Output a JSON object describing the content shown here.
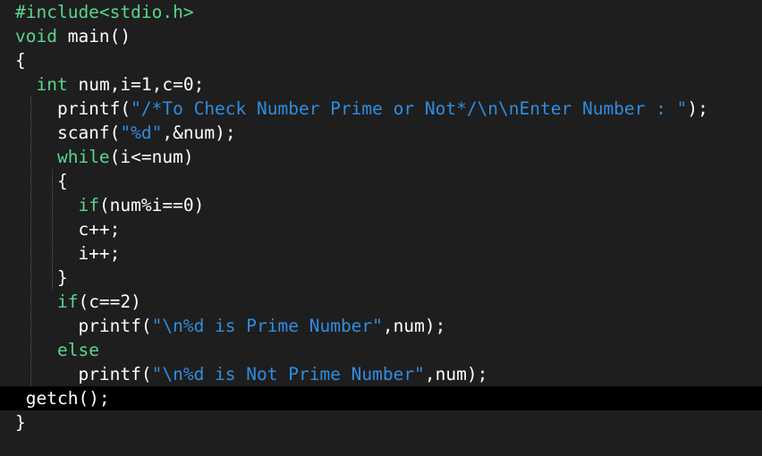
{
  "editor": {
    "lines": [
      [
        {
          "t": "#include<stdio.h>",
          "c": "pp"
        }
      ],
      [
        {
          "t": "void",
          "c": "kw"
        },
        {
          "t": " main()",
          "c": "tx"
        }
      ],
      [
        {
          "t": "{",
          "c": "tx"
        }
      ],
      [
        {
          "t": "  ",
          "c": "tx"
        },
        {
          "t": "int",
          "c": "kw"
        },
        {
          "t": " num,i=1,c=0;",
          "c": "tx"
        }
      ],
      [
        {
          "t": "    printf(",
          "c": "tx"
        },
        {
          "t": "\"/*To Check Number Prime or Not*/\\n\\nEnter Number : \"",
          "c": "str"
        },
        {
          "t": ");",
          "c": "tx"
        }
      ],
      [
        {
          "t": "    scanf(",
          "c": "tx"
        },
        {
          "t": "\"%d\"",
          "c": "str"
        },
        {
          "t": ",&num);",
          "c": "tx"
        }
      ],
      [
        {
          "t": "    ",
          "c": "tx"
        },
        {
          "t": "while",
          "c": "kw"
        },
        {
          "t": "(i<=num)",
          "c": "tx"
        }
      ],
      [
        {
          "t": "    {",
          "c": "tx"
        }
      ],
      [
        {
          "t": "      ",
          "c": "tx"
        },
        {
          "t": "if",
          "c": "kw"
        },
        {
          "t": "(num%i==0)",
          "c": "tx"
        }
      ],
      [
        {
          "t": "      c++;",
          "c": "tx"
        }
      ],
      [
        {
          "t": "      i++;",
          "c": "tx"
        }
      ],
      [
        {
          "t": "    }",
          "c": "tx"
        }
      ],
      [
        {
          "t": "    ",
          "c": "tx"
        },
        {
          "t": "if",
          "c": "kw"
        },
        {
          "t": "(c==2)",
          "c": "tx"
        }
      ],
      [
        {
          "t": "      printf(",
          "c": "tx"
        },
        {
          "t": "\"\\n%d is Prime Number\"",
          "c": "str"
        },
        {
          "t": ",num);",
          "c": "tx"
        }
      ],
      [
        {
          "t": "    ",
          "c": "tx"
        },
        {
          "t": "else",
          "c": "kw"
        }
      ],
      [
        {
          "t": "      printf(",
          "c": "tx"
        },
        {
          "t": "\"\\n%d is Not Prime Number\"",
          "c": "str"
        },
        {
          "t": ",num);",
          "c": "tx"
        }
      ],
      [
        {
          "t": " getch();",
          "c": "tx"
        }
      ],
      [
        {
          "t": "}",
          "c": "tx"
        }
      ]
    ],
    "current_line": 16
  },
  "colors": {
    "background": "#1e1e1e",
    "current_line": "#000000",
    "keyword": "#57d68d",
    "string": "#2f8de0",
    "text": "#ffffff"
  }
}
